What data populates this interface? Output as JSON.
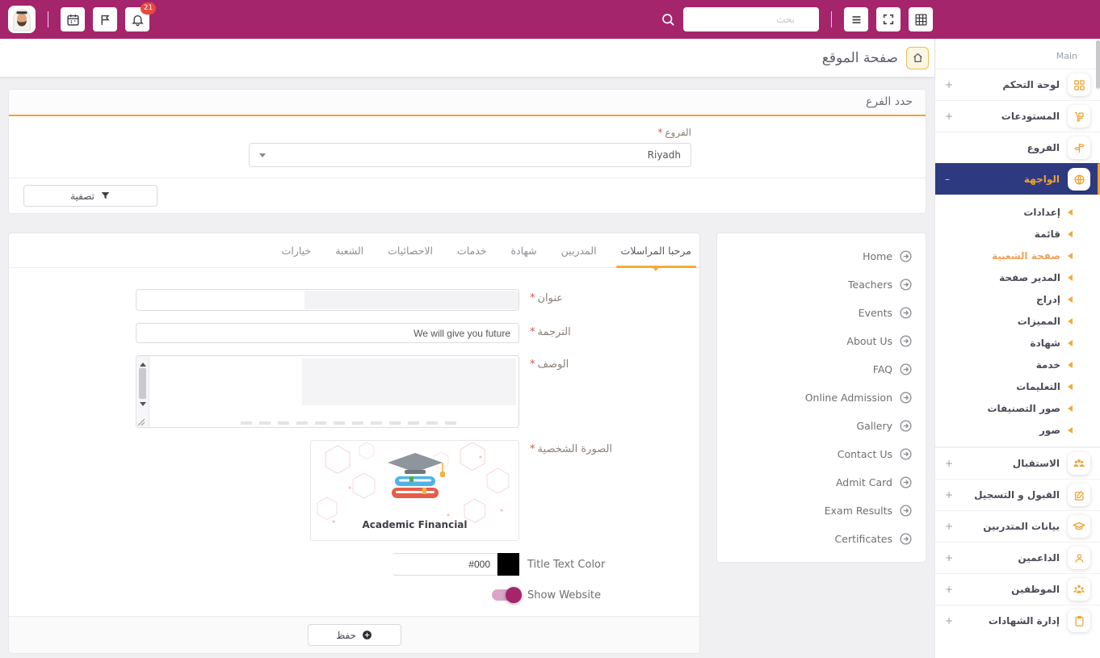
{
  "topbar": {
    "search_placeholder": "بحث",
    "notification_count": "21"
  },
  "page": {
    "title": "صفحة الموقع"
  },
  "sidebar": {
    "section_label": "Main",
    "items": [
      {
        "label": "لوحة التحكم",
        "expand": "+"
      },
      {
        "label": "المستودعات",
        "expand": "+"
      },
      {
        "label": "الفروع",
        "expand": ""
      },
      {
        "label": "الواجهة",
        "expand": "–"
      }
    ],
    "submenu": [
      "إعدادات",
      "قائمة",
      "صفحة الشعبية",
      "المدير صفحة",
      "إدراج",
      "المميزات",
      "شهادة",
      "خدمة",
      "التعليمات",
      "صور التصنيفات",
      "صور"
    ],
    "items_bottom": [
      {
        "label": "الاستقبال",
        "expand": "+"
      },
      {
        "label": "القبول و التسجيل",
        "expand": "+"
      },
      {
        "label": "بيانات المتدربين",
        "expand": "+"
      },
      {
        "label": "الداعمين",
        "expand": "+"
      },
      {
        "label": "الموظفين",
        "expand": "+"
      },
      {
        "label": "إدارة الشهادات",
        "expand": "+"
      }
    ]
  },
  "branch_card": {
    "title": "حدد الفرع",
    "field_label": "الفروع",
    "selected_value": "Riyadh",
    "filter_button": "تصفية"
  },
  "common": {
    "required": "*"
  },
  "form_card": {
    "tabs": [
      "مرحبا المراسلات",
      "المدربين",
      "شهادة",
      "خدمات",
      "الاحصائيات",
      "الشعبة",
      "خيارات"
    ],
    "fields": {
      "title_label": "عنوان",
      "translation_label": "الترجمة",
      "translation_value": "We will give you future",
      "description_label": "الوصف",
      "image_label": "الصورة الشخصية",
      "logo_text": "Academic Financial",
      "color_label": "Title Text Color",
      "color_value": "#000",
      "toggle_label": "Show Website"
    },
    "save_button": "حفظ"
  },
  "links_panel": {
    "items": [
      "Home",
      "Teachers",
      "Events",
      "About Us",
      "FAQ",
      "Online Admission",
      "Gallery",
      "Contact Us",
      "Admit Card",
      "Exam Results",
      "Certificates"
    ]
  },
  "colors": {
    "topbar": "#A5256D",
    "accent_orange": "#F0A12F",
    "active_blue": "#2E3A80",
    "badge_red": "#E8483F",
    "toggle_on": "#A5256D",
    "title_text_color_swatch": "#000000"
  }
}
